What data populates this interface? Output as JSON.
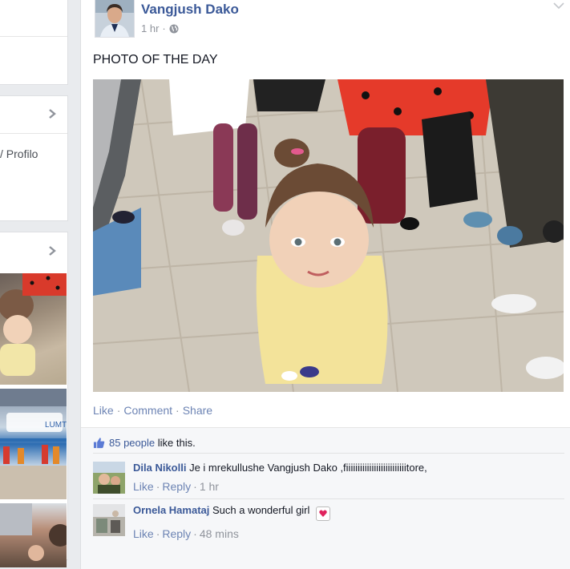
{
  "sidebar": {
    "profile_link_text": "/ Profilo"
  },
  "post": {
    "author": "Vangjush Dako",
    "time": "1 hr",
    "caption": "PHOTO OF THE DAY",
    "actions": {
      "like": "Like",
      "comment": "Comment",
      "share": "Share"
    },
    "likes": {
      "count": "85 people",
      "suffix": "like this."
    }
  },
  "comments": [
    {
      "name": "Dila Nikolli",
      "text": "Je i mrekullushe Vangjush Dako ,fiiiiiiiiiiiiiiiiiiiiiiiiiitore,",
      "like": "Like",
      "reply": "Reply",
      "time": "1 hr"
    },
    {
      "name": "Ornela Hamataj",
      "text": "Such a wonderful girl",
      "like": "Like",
      "reply": "Reply",
      "time": "48 mins"
    }
  ],
  "icons": {
    "globe": "globe-icon",
    "chevron": "chevron-right-icon",
    "like_thumb": "thumbs-up-icon",
    "post_menu": "chevron-down-icon",
    "heart": "heart-emoji-icon"
  },
  "colors": {
    "link_blue": "#3b5998",
    "action_blue": "#6d84b4",
    "meta_gray": "#90949c",
    "background": "#e9ebee"
  }
}
